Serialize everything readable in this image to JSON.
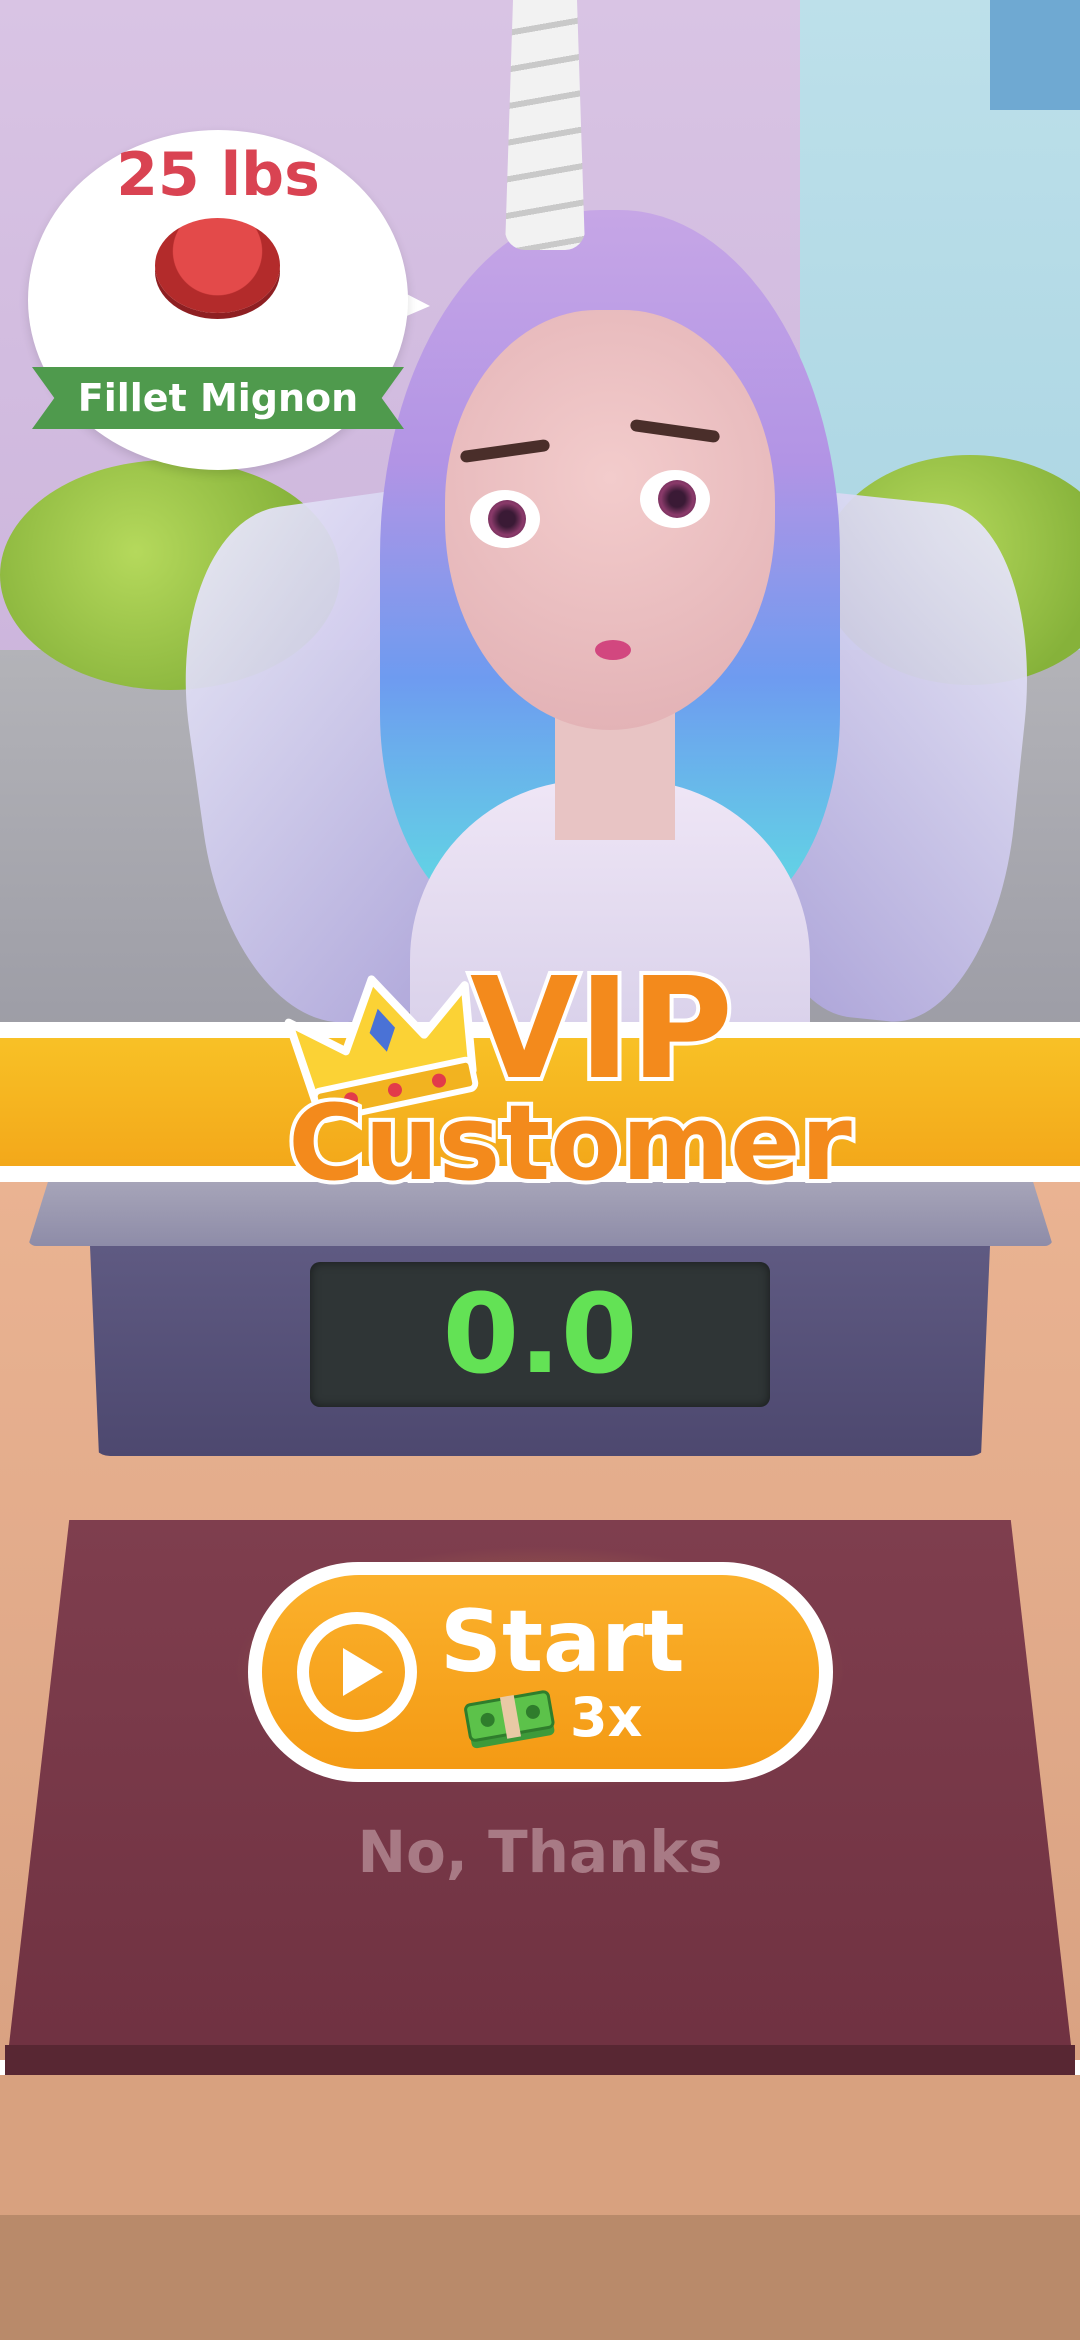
{
  "order": {
    "weight": "25 lbs",
    "item_name": "Fillet Mignon",
    "item_icon": "steak-icon"
  },
  "banner": {
    "vip_text": "VIP",
    "customer_text": "Customer",
    "icon": "crown-icon"
  },
  "scale": {
    "readout": "0.0"
  },
  "actions": {
    "start_label": "Start",
    "start_icon": "play-icon",
    "reward_icon": "cash-icon",
    "multiplier": "3x",
    "decline_label": "No, Thanks"
  },
  "colors": {
    "accent_orange": "#f38a1c",
    "banner_yellow": "#f8c126",
    "order_ribbon_green": "#4f9a4d",
    "weight_red": "#d94352",
    "readout_green": "#63e255"
  }
}
